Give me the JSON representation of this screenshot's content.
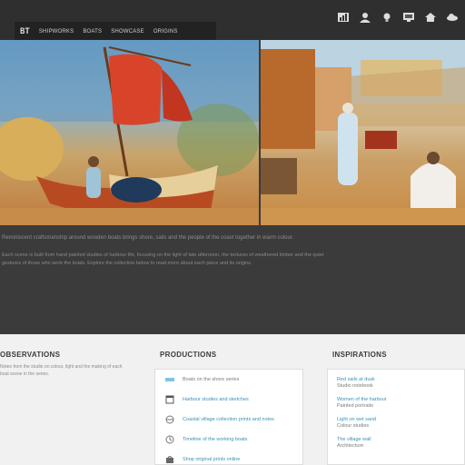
{
  "nav": {
    "logo": "BT",
    "links": [
      "SHIPWORKS",
      "BOATS",
      "SHOWCASE",
      "ORIGINS"
    ]
  },
  "toolbar": {
    "icons": [
      "chart-icon",
      "user-icon",
      "bulb-icon",
      "monitor-icon",
      "home-icon",
      "cloud-icon"
    ]
  },
  "hero": {
    "left_alt": "Painting of a red-sailed boat on a beach",
    "right_alt": "Painting of a coastal village with figures"
  },
  "description": {
    "lead": "Reminiscent craftsmanship around wooden boats brings shore, sails and the people of the coast together in warm colour.",
    "body": "Each scene is built from hand painted studies of harbour life, focusing on the light of late afternoon, the textures of weathered timber and the quiet gestures of those who work the boats. Explore the collection below to read more about each piece and its origins."
  },
  "footer": {
    "col1": {
      "title": "OBSERVATIONS",
      "text": "Notes from the studio on colour, light and the making of each boat scene in the series."
    },
    "col2": {
      "title": "PRODUCTIONS",
      "rows": [
        {
          "icon": "page-icon",
          "text": "Boats on the shore series",
          "style": "gray"
        },
        {
          "icon": "window-icon",
          "text": "Harbour studies and sketches"
        },
        {
          "icon": "globe-icon",
          "text": "Coastal village collection prints and notes"
        },
        {
          "icon": "clock-icon",
          "text": "Timeline of the working boats"
        },
        {
          "icon": "bag-icon",
          "text": "Shop original prints online"
        }
      ]
    },
    "col3": {
      "title": "INSPIRATIONS",
      "items": [
        {
          "title": "Red sails at dusk",
          "sub": "Studio notebook"
        },
        {
          "title": "Women of the harbour",
          "sub": "Painted portraits"
        },
        {
          "title": "Light on wet sand",
          "sub": "Colour studies"
        },
        {
          "title": "The village wall",
          "sub": "Architecture"
        }
      ]
    }
  }
}
